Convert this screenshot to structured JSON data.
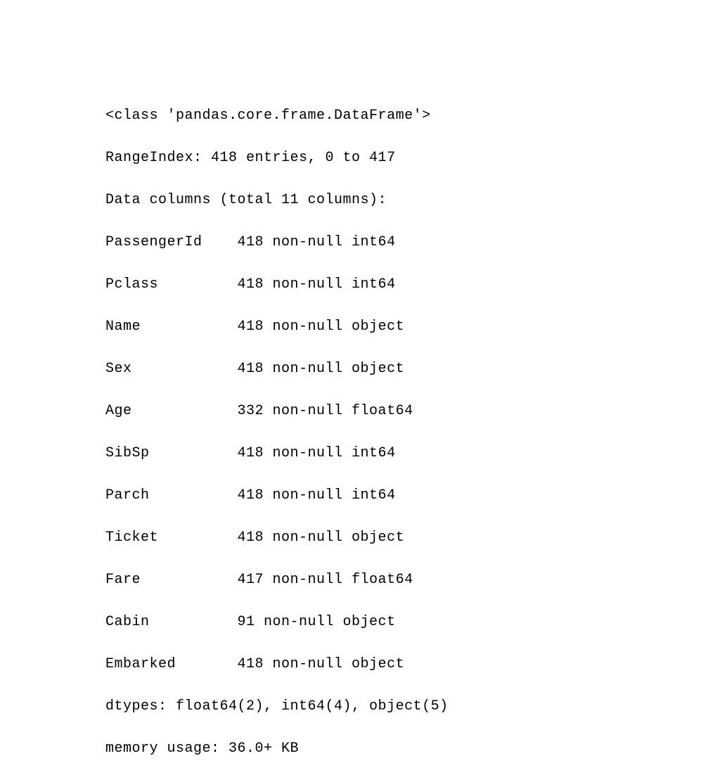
{
  "header": {
    "class_line": "<class 'pandas.core.frame.DataFrame'>",
    "range_index": "RangeIndex: 418 entries, 0 to 417",
    "data_columns": "Data columns (total 11 columns):"
  },
  "columns": [
    {
      "name": "PassengerId",
      "padded": "PassengerId    418 non-null int64"
    },
    {
      "name": "Pclass",
      "padded": "Pclass         418 non-null int64"
    },
    {
      "name": "Name",
      "padded": "Name           418 non-null object"
    },
    {
      "name": "Sex",
      "padded": "Sex            418 non-null object"
    },
    {
      "name": "Age",
      "padded": "Age            332 non-null float64"
    },
    {
      "name": "SibSp",
      "padded": "SibSp          418 non-null int64"
    },
    {
      "name": "Parch",
      "padded": "Parch          418 non-null int64"
    },
    {
      "name": "Ticket",
      "padded": "Ticket         418 non-null object"
    },
    {
      "name": "Fare",
      "padded": "Fare           417 non-null float64"
    },
    {
      "name": "Cabin",
      "padded": "Cabin          91 non-null object"
    },
    {
      "name": "Embarked",
      "padded": "Embarked       418 non-null object"
    }
  ],
  "footer": {
    "dtypes": "dtypes: float64(2), int64(4), object(5)",
    "memory": "memory usage: 36.0+ KB"
  }
}
